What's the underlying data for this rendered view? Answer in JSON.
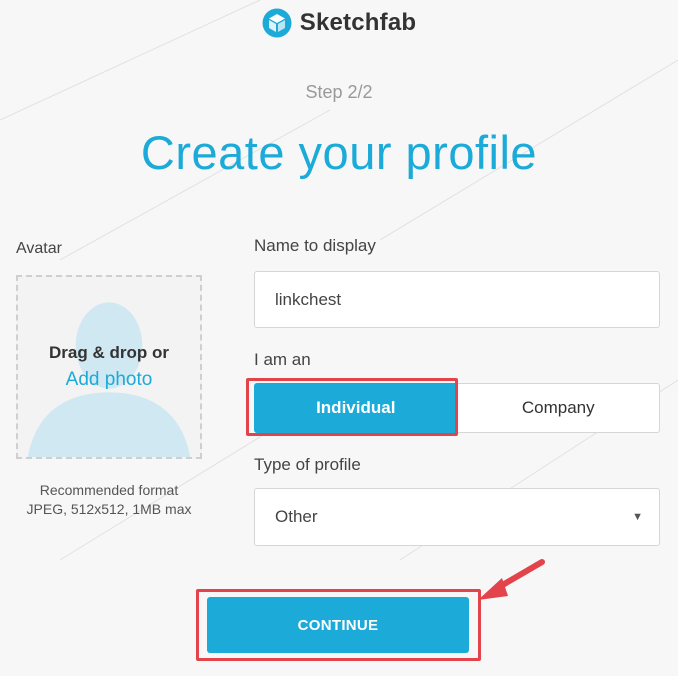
{
  "brand": {
    "name": "Sketchfab",
    "logo_icon": "sketchfab-cube-icon"
  },
  "header": {
    "step": "Step 2/2",
    "title": "Create your profile"
  },
  "avatar": {
    "label": "Avatar",
    "drop_text": "Drag & drop or",
    "add_photo": "Add photo",
    "recommend_line1": "Recommended format",
    "recommend_line2": "JPEG, 512x512, 1MB max"
  },
  "form": {
    "name_label": "Name to display",
    "name_value": "linkchest",
    "iam_label": "I am an",
    "options": [
      {
        "label": "Individual",
        "selected": true
      },
      {
        "label": "Company",
        "selected": false
      }
    ],
    "type_label": "Type of profile",
    "type_value": "Other"
  },
  "actions": {
    "continue_label": "CONTINUE"
  },
  "colors": {
    "accent": "#1caad9",
    "annotation": "#e3434a",
    "background": "#f7f7f7"
  }
}
